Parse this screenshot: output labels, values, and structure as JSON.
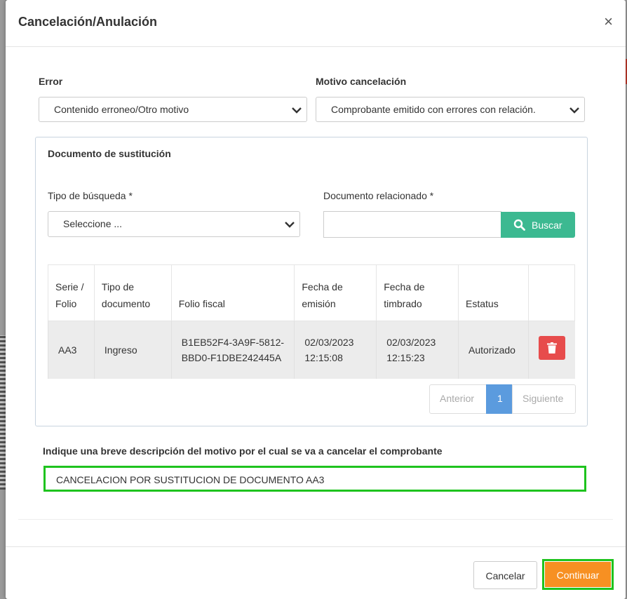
{
  "modal": {
    "title": "Cancelación/Anulación",
    "close_symbol": "×"
  },
  "form": {
    "error_label": "Error",
    "error_value": "Contenido erroneo/Otro motivo",
    "motivo_label": "Motivo cancelación",
    "motivo_value": "Comprobante emitido con errores con relación."
  },
  "substitution": {
    "title": "Documento de sustitución",
    "tipo_busqueda_label": "Tipo de búsqueda *",
    "tipo_busqueda_value": "Seleccione ...",
    "doc_relacionado_label": "Documento relacionado *",
    "doc_relacionado_value": "",
    "buscar_label": "Buscar",
    "table": {
      "headers": [
        "Serie / Folio",
        "Tipo de documento",
        "Folio fiscal",
        "Fecha de emisión",
        "Fecha de timbrado",
        "Estatus"
      ],
      "rows": [
        {
          "serie_folio": "AA3",
          "tipo_documento": "Ingreso",
          "folio_fiscal": "B1EB52F4-3A9F-5812-BBD0-F1DBE242445A",
          "fecha_emision": "02/03/2023 12:15:08",
          "fecha_timbrado": "02/03/2023 12:15:23",
          "estatus": "Autorizado"
        }
      ]
    },
    "pagination": {
      "prev": "Anterior",
      "current": "1",
      "next": "Siguiente"
    }
  },
  "description": {
    "label": "Indique una breve descripción del motivo por el cual se va a cancelar el comprobante",
    "value": "CANCELACION POR SUSTITUCION DE DOCUMENTO AA3"
  },
  "footer": {
    "cancel_label": "Cancelar",
    "continue_label": "Continuar"
  },
  "colors": {
    "buscar_button": "#3cb991",
    "delete_button": "#e74c4c",
    "page_active": "#5b9bde",
    "continue_button": "#f79022",
    "highlight_border": "#1ec31e"
  }
}
